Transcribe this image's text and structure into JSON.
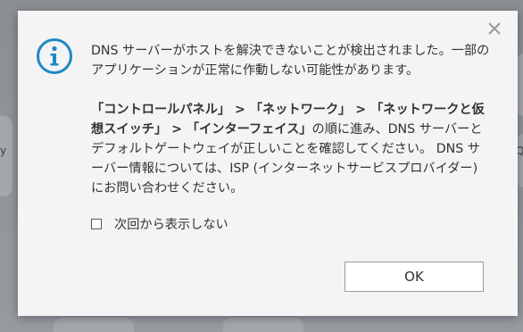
{
  "dialog": {
    "message_para1": "DNS サーバーがホストを解決できないことが検出されました。一部のアプリケーションが正常に作動しない可能性があります。",
    "message_para2_bold": "「コントロールパネル」 > 「ネットワーク」 > 「ネットワークと仮想スイッチ」 > 「インターフェイス」",
    "message_para2_rest": "の順に進み、DNS サーバーとデフォルトゲートウェイが正しいことを確認してください。 DNS サーバー情報については、ISP (インターネットサービスプロバイダー) にお問い合わせください。",
    "checkbox_label": "次回から表示しない",
    "checkbox_checked": false,
    "ok_label": "OK",
    "icons": {
      "info": "info-icon",
      "close": "close-icon"
    },
    "colors": {
      "info_icon": "#1e88c8",
      "dialog_bg": "#f4f4f4",
      "text": "#333333"
    }
  },
  "background": {
    "left_partial_text": "y",
    "right_partial_text": "Q"
  }
}
